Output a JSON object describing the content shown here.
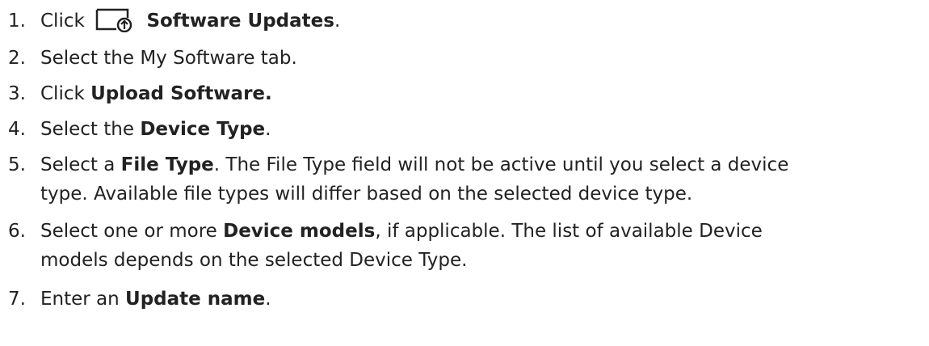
{
  "steps": [
    {
      "number": "1.",
      "before": "Click",
      "icon": "software-updates-icon",
      "bold": "Software Updates",
      "after": "."
    },
    {
      "number": "2.",
      "text": "Select the My Software tab."
    },
    {
      "number": "3.",
      "before": "Click ",
      "bold": "Upload Software.",
      "after": ""
    },
    {
      "number": "4.",
      "before": "Select the ",
      "bold": "Device Type",
      "after": "."
    },
    {
      "number": "5.",
      "before": "Select a ",
      "bold": "File Type",
      "after": ". The File Type field will not be active until you select a device",
      "line2": "type. Available file types will differ based on the selected device type."
    },
    {
      "number": "6.",
      "before": "Select one or more ",
      "bold": "Device models",
      "after": ", if applicable. The list of available Device",
      "line2": "models depends on the selected Device Type."
    },
    {
      "number": "7.",
      "before": "Enter an ",
      "bold": "Update name",
      "after": "."
    }
  ]
}
